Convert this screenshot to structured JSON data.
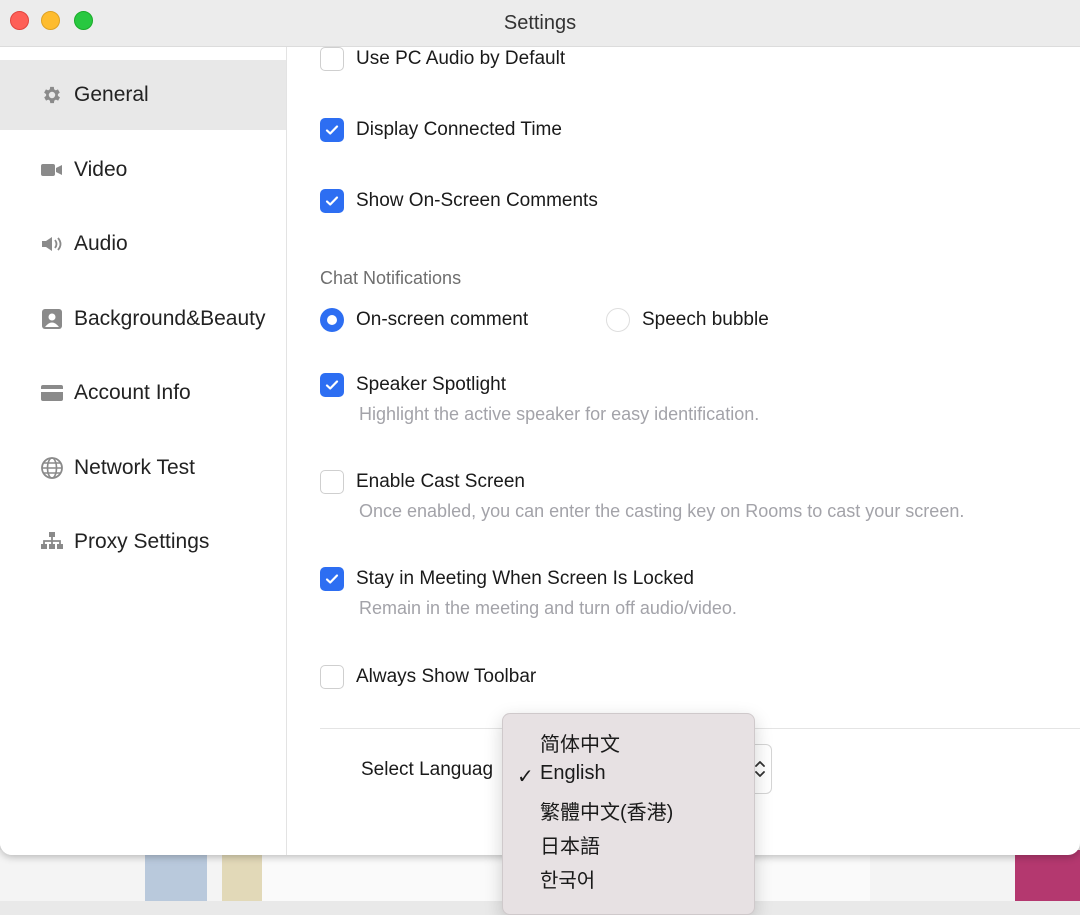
{
  "window": {
    "title": "Settings"
  },
  "sidebar": {
    "items": [
      {
        "label": "General",
        "icon": "gear-icon",
        "active": true
      },
      {
        "label": "Video",
        "icon": "video-icon"
      },
      {
        "label": "Audio",
        "icon": "speaker-icon"
      },
      {
        "label": "Background&Beauty",
        "icon": "portrait-icon"
      },
      {
        "label": "Account Info",
        "icon": "card-icon"
      },
      {
        "label": "Network Test",
        "icon": "globe-icon"
      },
      {
        "label": "Proxy Settings",
        "icon": "network-tree-icon"
      }
    ]
  },
  "general": {
    "use_pc_audio": {
      "label": "Use PC Audio by Default",
      "checked": false
    },
    "display_connected_time": {
      "label": "Display Connected Time",
      "checked": true
    },
    "show_on_screen_comments": {
      "label": "Show On-Screen Comments",
      "checked": true
    },
    "chat_notifications": {
      "label": "Chat Notifications",
      "options": [
        {
          "label": "On-screen comment",
          "selected": true
        },
        {
          "label": "Speech bubble",
          "selected": false
        }
      ]
    },
    "speaker_spotlight": {
      "label": "Speaker Spotlight",
      "checked": true,
      "description": "Highlight the active speaker for easy identification."
    },
    "enable_cast_screen": {
      "label": "Enable Cast Screen",
      "checked": false,
      "description": "Once enabled, you can enter the casting key on Rooms to cast your screen."
    },
    "stay_in_meeting": {
      "label": "Stay in Meeting When Screen Is Locked",
      "checked": true,
      "description": "Remain in the meeting and turn off audio/video."
    },
    "always_show_toolbar": {
      "label": "Always Show Toolbar",
      "checked": false
    },
    "language": {
      "label": "Select Languag",
      "selected": "English",
      "options": [
        "简体中文",
        "English",
        "繁體中文(香港)",
        "日本語",
        "한국어"
      ]
    }
  },
  "colors": {
    "accent": "#2d6ef2",
    "traffic_red": "#fe5f57",
    "traffic_yellow": "#febc2e",
    "traffic_green": "#28c840"
  }
}
